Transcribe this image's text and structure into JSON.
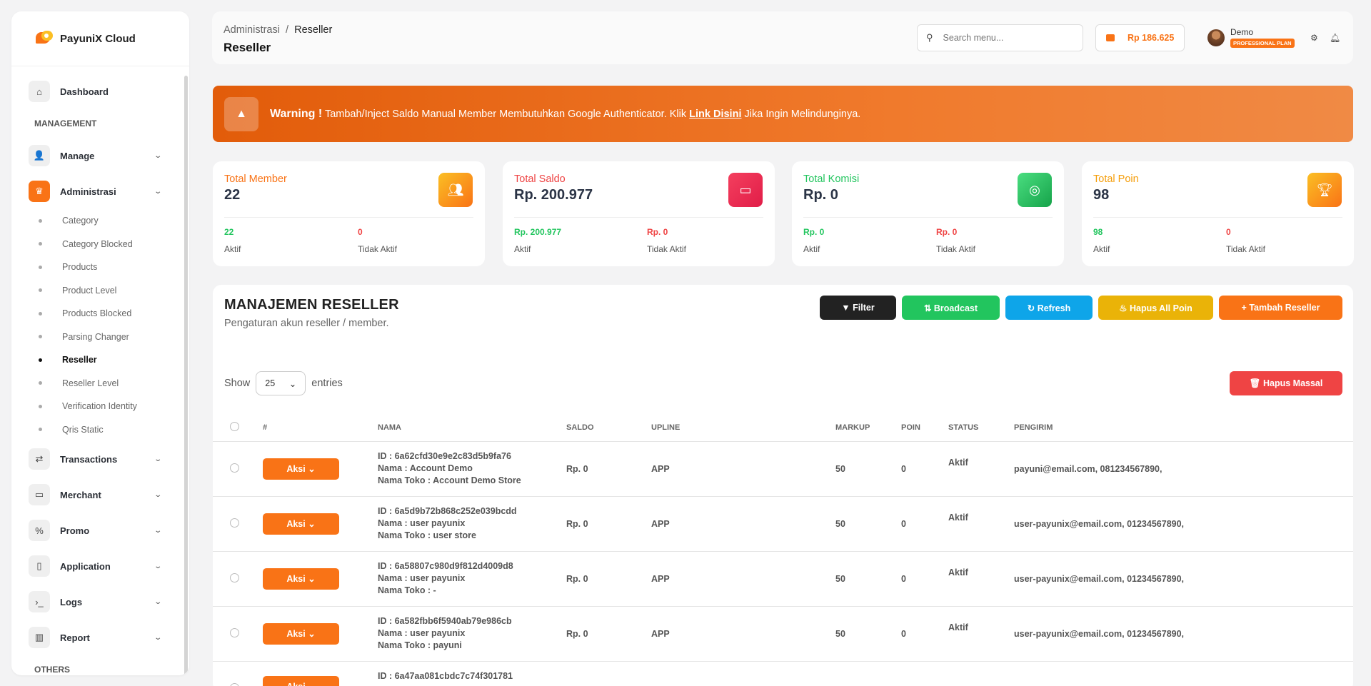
{
  "brand": {
    "name": "PayuniX Cloud"
  },
  "sidebar": {
    "dashboard": "Dashboard",
    "section_management": "MANAGEMENT",
    "manage": "Manage",
    "administrasi": "Administrasi",
    "sub_items": [
      "Category",
      "Category Blocked",
      "Products",
      "Product Level",
      "Products Blocked",
      "Parsing Changer",
      "Reseller",
      "Reseller Level",
      "Verification Identity",
      "Qris Static"
    ],
    "transactions": "Transactions",
    "merchant": "Merchant",
    "promo": "Promo",
    "application": "Application",
    "logs": "Logs",
    "report": "Report",
    "section_others": "OTHERS"
  },
  "header": {
    "breadcrumb_parent": "Administrasi",
    "breadcrumb_sep": "/",
    "breadcrumb_current": "Reseller",
    "title": "Reseller",
    "search_placeholder": "Search menu...",
    "balance": "Rp 186.625",
    "user_name": "Demo",
    "plan": "PROFESSIONAL PLAN"
  },
  "warning": {
    "label": "Warning !",
    "text": "Tambah/Inject Saldo Manual Member Membutuhkan Google Authenticator. Klik",
    "link": "Link Disini",
    "text_after": "Jika Ingin Melindunginya."
  },
  "stats": [
    {
      "title": "Total Member",
      "value": "22",
      "active": "22",
      "inactive": "0",
      "active_label": "Aktif",
      "inactive_label": "Tidak Aktif",
      "color": "#f97316",
      "icon": "users-icon"
    },
    {
      "title": "Total Saldo",
      "value": "Rp. 200.977",
      "active": "Rp. 200.977",
      "inactive": "Rp. 0",
      "active_label": "Aktif",
      "inactive_label": "Tidak Aktif",
      "color": "#ef4444",
      "icon": "wallet-icon"
    },
    {
      "title": "Total Komisi",
      "value": "Rp. 0",
      "active": "Rp. 0",
      "inactive": "Rp. 0",
      "active_label": "Aktif",
      "inactive_label": "Tidak Aktif",
      "color": "#22c55e",
      "icon": "coins-icon"
    },
    {
      "title": "Total Poin",
      "value": "98",
      "active": "98",
      "inactive": "0",
      "active_label": "Aktif",
      "inactive_label": "Tidak Aktif",
      "color": "#f59e0b",
      "icon": "trophy-icon"
    }
  ],
  "panel": {
    "title": "MANAJEMEN RESELLER",
    "subtitle": "Pengaturan akun reseller / member.",
    "btn_filter": "▼ Filter",
    "btn_broadcast": "⇅ Broadcast",
    "btn_refresh": "↻ Refresh",
    "btn_hapus_poin": "♨ Hapus All Poin",
    "btn_tambah": "+ Tambah Reseller",
    "btn_hapus_massal": "🗑 Hapus Massal",
    "show_label": "Show",
    "entries_value": "25",
    "entries_label": "entries"
  },
  "table": {
    "headers": [
      "#",
      "NAMA",
      "SALDO",
      "UPLINE",
      "MARKUP",
      "POIN",
      "STATUS",
      "PENGIRIM"
    ],
    "aksi_label": "Aksi",
    "rows": [
      {
        "id": "ID : 6a62cfd30e9e2c83d5b9fa76",
        "nama": "Nama : Account Demo",
        "toko": "Nama Toko : Account Demo Store",
        "saldo": "Rp. 0",
        "upline": "APP",
        "markup": "50",
        "poin": "0",
        "status": "Aktif",
        "pengirim": "payuni@email.com, 081234567890,"
      },
      {
        "id": "ID : 6a5d9b72b868c252e039bcdd",
        "nama": "Nama : user payunix",
        "toko": "Nama Toko : user store",
        "saldo": "Rp. 0",
        "upline": "APP",
        "markup": "50",
        "poin": "0",
        "status": "Aktif",
        "pengirim": "user-payunix@email.com, 01234567890,"
      },
      {
        "id": "ID : 6a58807c980d9f812d4009d8",
        "nama": "Nama : user payunix",
        "toko": "Nama Toko : -",
        "saldo": "Rp. 0",
        "upline": "APP",
        "markup": "50",
        "poin": "0",
        "status": "Aktif",
        "pengirim": "user-payunix@email.com, 01234567890,"
      },
      {
        "id": "ID : 6a582fbb6f5940ab79e986cb",
        "nama": "Nama : user payunix",
        "toko": "Nama Toko : payuni",
        "saldo": "Rp. 0",
        "upline": "APP",
        "markup": "50",
        "poin": "0",
        "status": "Aktif",
        "pengirim": "user-payunix@email.com, 01234567890,"
      },
      {
        "id": "ID : 6a47aa081cbdc7c74f301781",
        "nama": "",
        "toko": "",
        "saldo": "",
        "upline": "",
        "markup": "",
        "poin": "",
        "status": "",
        "pengirim": ""
      }
    ]
  }
}
